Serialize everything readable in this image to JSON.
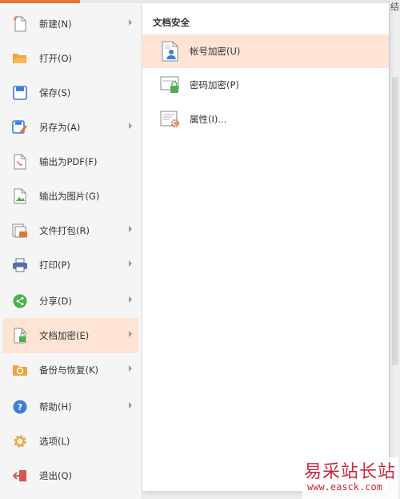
{
  "background": {
    "right_edge_glyph": "结"
  },
  "menu": {
    "items": [
      {
        "label": "新建(N)",
        "icon": "new-document-icon",
        "has_submenu": true
      },
      {
        "label": "打开(O)",
        "icon": "open-folder-icon",
        "has_submenu": false
      },
      {
        "label": "保存(S)",
        "icon": "save-icon",
        "has_submenu": false
      },
      {
        "label": "另存为(A)",
        "icon": "save-as-icon",
        "has_submenu": true
      },
      {
        "label": "输出为PDF(F)",
        "icon": "export-pdf-icon",
        "has_submenu": false
      },
      {
        "label": "输出为图片(G)",
        "icon": "export-image-icon",
        "has_submenu": false
      },
      {
        "label": "文件打包(R)",
        "icon": "package-icon",
        "has_submenu": true
      },
      {
        "label": "打印(P)",
        "icon": "printer-icon",
        "has_submenu": true
      },
      {
        "label": "分享(D)",
        "icon": "share-icon",
        "has_submenu": true
      },
      {
        "label": "文档加密(E)",
        "icon": "document-encrypt-icon",
        "has_submenu": true,
        "active": true
      },
      {
        "label": "备份与恢复(K)",
        "icon": "backup-restore-icon",
        "has_submenu": true
      },
      {
        "label": "帮助(H)",
        "icon": "help-icon",
        "has_submenu": true
      },
      {
        "label": "选项(L)",
        "icon": "options-gear-icon",
        "has_submenu": false
      },
      {
        "label": "退出(Q)",
        "icon": "exit-icon",
        "has_submenu": false
      }
    ]
  },
  "submenu": {
    "title": "文档安全",
    "items": [
      {
        "label": "帐号加密(U)",
        "icon": "account-encrypt-icon",
        "active": true
      },
      {
        "label": "密码加密(P)",
        "icon": "password-encrypt-icon"
      },
      {
        "label": "属性(I)...",
        "icon": "properties-icon"
      }
    ]
  },
  "watermark": {
    "title": "易采站长站",
    "url": "www.easck.com"
  },
  "colors": {
    "accent": "#e8743b",
    "active_bg": "#fde4d5",
    "menu_bg": "#f5f5f5",
    "watermark": "#c8283c"
  }
}
